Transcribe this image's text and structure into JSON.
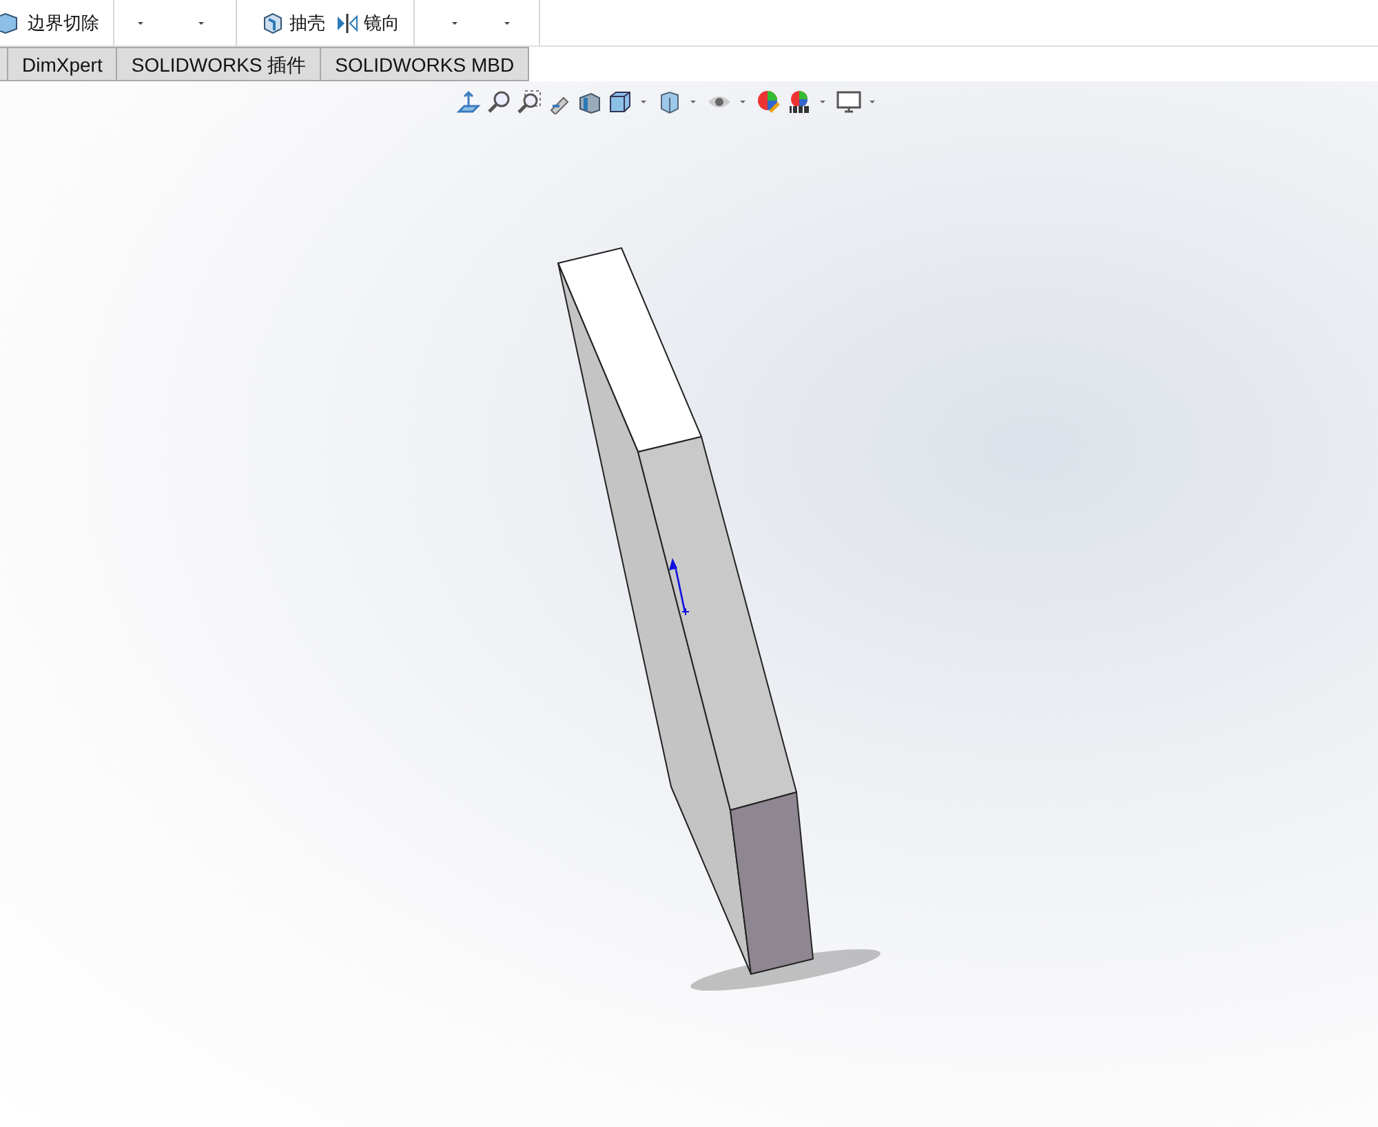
{
  "toolbar": {
    "items": [
      {
        "kind": "command",
        "label": "边界切除"
      },
      {
        "kind": "dropdown"
      },
      {
        "kind": "dropdown"
      },
      {
        "kind": "command",
        "label": "抽壳"
      },
      {
        "kind": "command",
        "label": "镜向"
      },
      {
        "kind": "dropdown"
      },
      {
        "kind": "dropdown"
      }
    ]
  },
  "tabs": [
    {
      "label": "DimXpert",
      "selected": false
    },
    {
      "label": "SOLIDWORKS 插件",
      "selected": false
    },
    {
      "label": "SOLIDWORKS MBD",
      "selected": false
    }
  ]
}
